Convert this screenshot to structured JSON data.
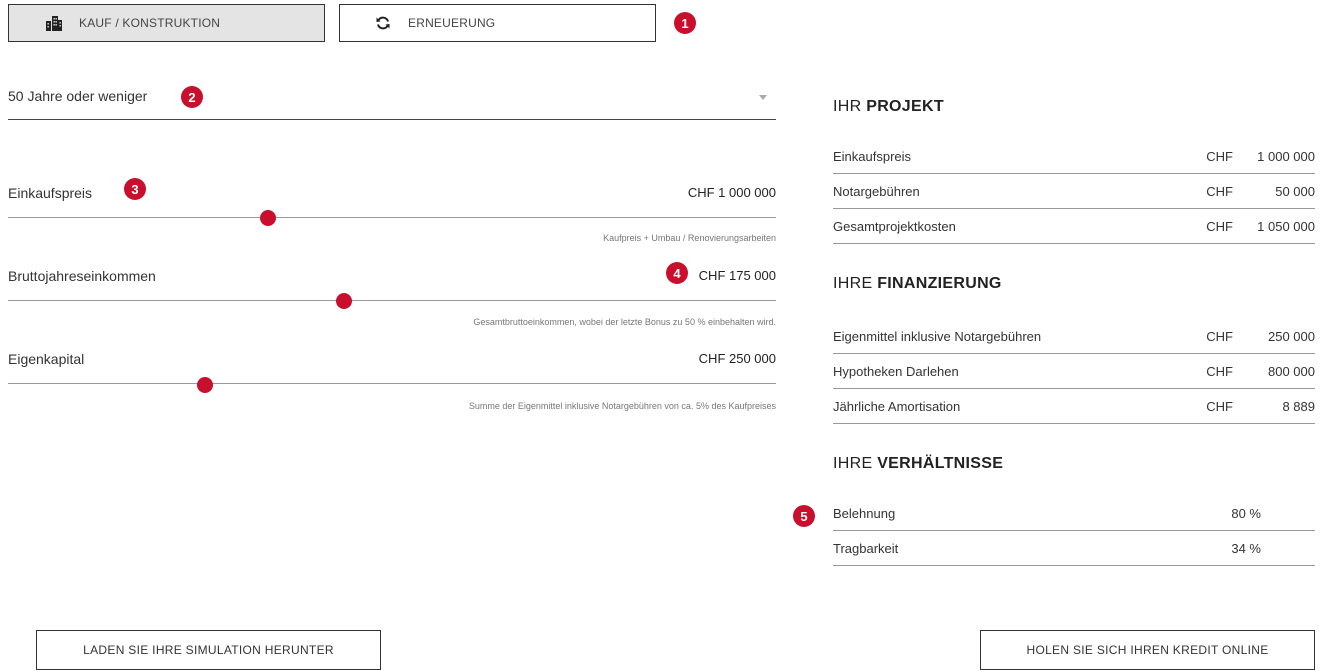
{
  "tabs": [
    {
      "label": "KAUF / KONSTRUKTION",
      "icon": "building-icon",
      "active": true
    },
    {
      "label": "ERNEUERUNG",
      "icon": "refresh-icon",
      "active": false
    }
  ],
  "badges": [
    "1",
    "2",
    "3",
    "4",
    "5"
  ],
  "age_select": {
    "value": "50 Jahre oder weniger"
  },
  "sliders": [
    {
      "label": "Einkaufspreis",
      "value": "CHF 1 000 000",
      "hint": "Kaufpreis + Umbau / Renovierungsarbeiten",
      "level": 0.338
    },
    {
      "label": "Bruttojahreseinkommen",
      "value": "CHF 175 000",
      "hint": "Gesamtbruttoeinkommen, wobei der letzte Bonus zu 50 % einbehalten wird.",
      "level": 0.438
    },
    {
      "label": "Eigenkapital",
      "value": "CHF 250 000",
      "hint": "Summe der Eigenmittel inklusive Notargebühren von ca. 5% des Kaufpreises",
      "level": 0.256
    }
  ],
  "project": {
    "title_prefix": "IHR",
    "title_bold": "PROJEKT",
    "rows": [
      {
        "label": "Einkaufspreis",
        "currency": "CHF",
        "value": "1 000 000"
      },
      {
        "label": "Notargebühren",
        "currency": "CHF",
        "value": "50 000"
      },
      {
        "label": "Gesamtprojektkosten",
        "currency": "CHF",
        "value": "1 050 000"
      }
    ]
  },
  "financing": {
    "title_prefix": "IHRE",
    "title_bold": "FINANZIERUNG",
    "rows": [
      {
        "label": "Eigenmittel inklusive Notargebühren",
        "currency": "CHF",
        "value": "250 000"
      },
      {
        "label": "Hypotheken Darlehen",
        "currency": "CHF",
        "value": "800 000"
      },
      {
        "label": "Jährliche Amortisation",
        "currency": "CHF",
        "value": "8 889"
      }
    ]
  },
  "ratios": {
    "title_prefix": "IHRE",
    "title_bold": "VERHÄLTNISSE",
    "rows": [
      {
        "label": "Belehnung",
        "value": "80 %"
      },
      {
        "label": "Tragbarkeit",
        "value": "34 %"
      }
    ]
  },
  "buttons": {
    "download": "LADEN SIE IHRE SIMULATION HERUNTER",
    "credit": "HOLEN SIE SICH IHREN KREDIT ONLINE"
  },
  "colors": {
    "accent": "#c8102e",
    "active_tab_bg": "#e4e4e4"
  }
}
